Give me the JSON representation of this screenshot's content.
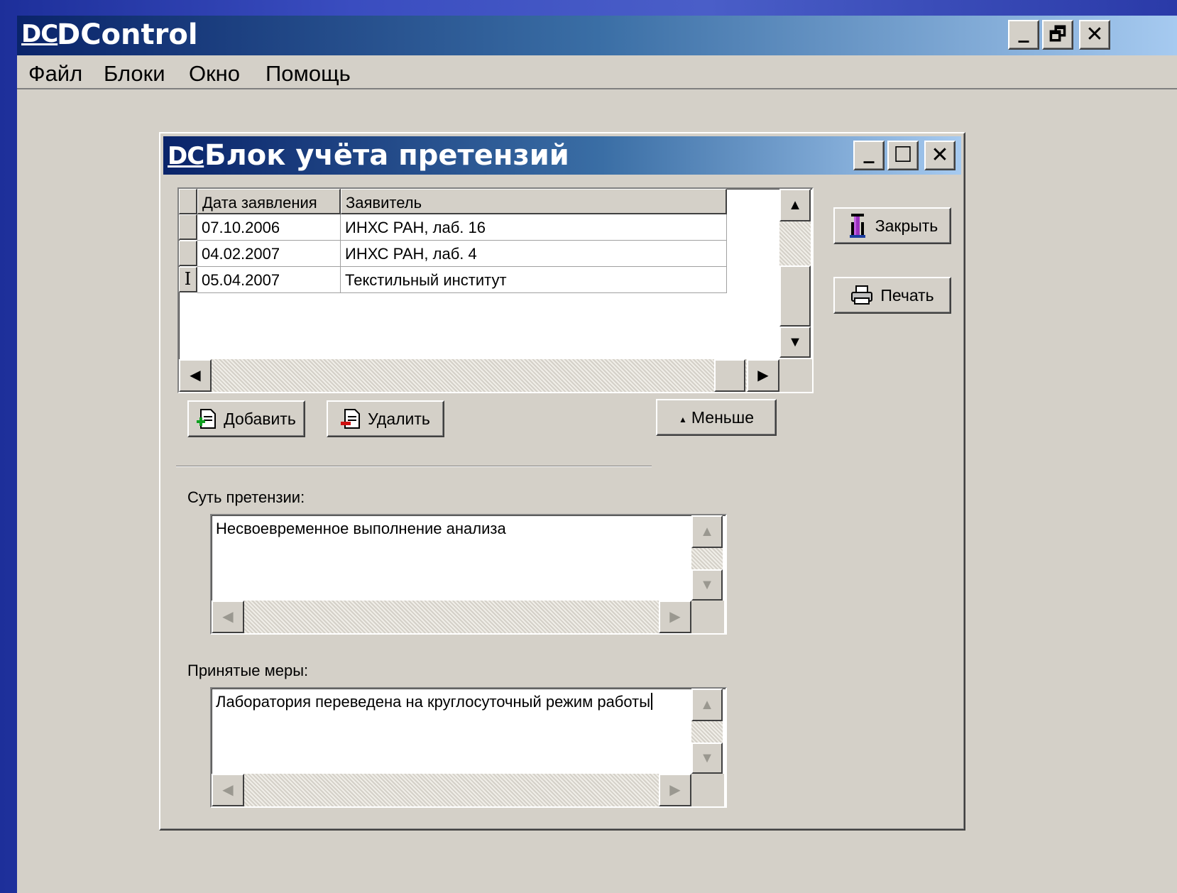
{
  "app": {
    "logo": "DC",
    "title": "DControl",
    "window_buttons": {
      "minimize": "_",
      "restore": "🗗",
      "close": "✕"
    },
    "menu": [
      "Файл",
      "Блоки",
      "Окно",
      "Помощь"
    ]
  },
  "child": {
    "logo": "DC",
    "title": "Блок учёта претензий",
    "window_buttons": {
      "minimize": "_",
      "maximize": "☐",
      "close": "✕"
    }
  },
  "grid": {
    "columns": [
      "Дата заявления",
      "Заявитель"
    ],
    "rows": [
      {
        "indicator": "",
        "date": "07.10.2006",
        "applicant": "ИНХС РАН, лаб. 16"
      },
      {
        "indicator": "",
        "date": "04.02.2007",
        "applicant": "ИНХС РАН, лаб. 4"
      },
      {
        "indicator": "I",
        "date": "05.04.2007",
        "applicant": "Текстильный институт"
      }
    ]
  },
  "buttons": {
    "close": "Закрыть",
    "print": "Печать",
    "add": "Добавить",
    "delete": "Удалить",
    "less": "Меньше",
    "less_arrow": "▲"
  },
  "claim": {
    "label": "Суть претензии:",
    "value": "Несвоевременное выполнение анализа"
  },
  "measures": {
    "label": "Принятые меры:",
    "value": "Лаборатория переведена на круглосуточный режим работы"
  }
}
